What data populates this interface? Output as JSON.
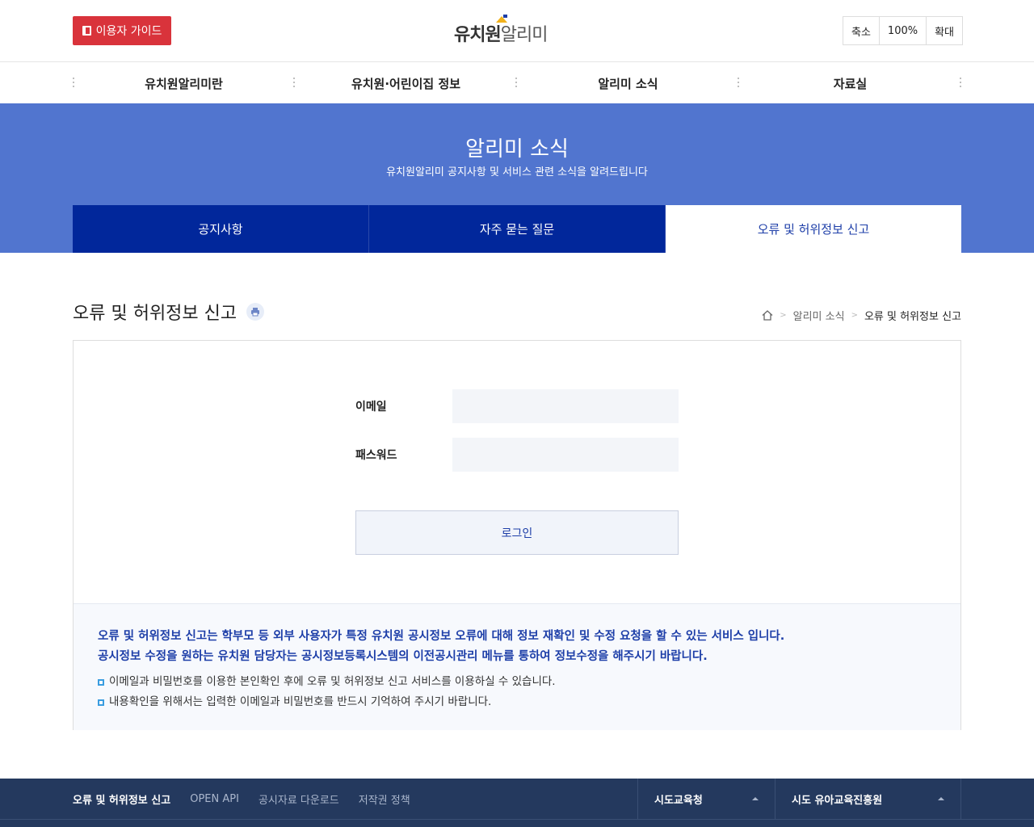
{
  "header": {
    "guide_label": "이용자 가이드",
    "logo_main": "유치원",
    "logo_sub": "알리미",
    "zoom": {
      "out": "축소",
      "level": "100%",
      "in": "확대"
    }
  },
  "nav": {
    "items": [
      "유치원알리미란",
      "유치원·어린이집 정보",
      "알리미 소식",
      "자료실"
    ]
  },
  "banner": {
    "title": "알리미 소식",
    "subtitle": "유치원알리미 공지사항 및 서비스 관련 소식을 알려드립니다",
    "tabs": [
      {
        "label": "공지사항",
        "active": false
      },
      {
        "label": "자주 묻는 질문",
        "active": false
      },
      {
        "label": "오류 및 허위정보 신고",
        "active": true
      }
    ]
  },
  "page": {
    "title": "오류 및 허위정보 신고",
    "breadcrumb": [
      "알리미 소식",
      "오류 및 허위정보 신고"
    ]
  },
  "form": {
    "email_label": "이메일",
    "email_value": "",
    "password_label": "패스워드",
    "password_value": "",
    "login_label": "로그인"
  },
  "info": {
    "strong_lines": [
      "오류 및 허위정보 신고는 학부모 등 외부 사용자가 특정 유치원 공시정보 오류에 대해 정보 재확인 및 수정 요청을 할 수 있는 서비스 입니다.",
      "공시정보 수정을 원하는 유치원 담당자는 공시정보등록시스템의 이전공시관리 메뉴를 통하여 정보수정을 해주시기 바랍니다."
    ],
    "items": [
      "이메일과 비밀번호를 이용한 본인확인 후에 오류 및 허위정보 신고 서비스를 이용하실 수 있습니다.",
      "내용확인을 위해서는 입력한 이메일과 비밀번호를 반드시 기억하여 주시기 바랍니다."
    ]
  },
  "footer": {
    "links": [
      "오류 및 허위정보 신고",
      "OPEN API",
      "공시자료 다운로드",
      "저작권 정책"
    ],
    "select1": "시도교육청",
    "select2": "시도 유아교육진흥원"
  },
  "colors": {
    "accent_red": "#d9333b",
    "banner_blue": "#5175cf",
    "tab_navy": "#01279b",
    "footer_navy": "#24395e"
  }
}
